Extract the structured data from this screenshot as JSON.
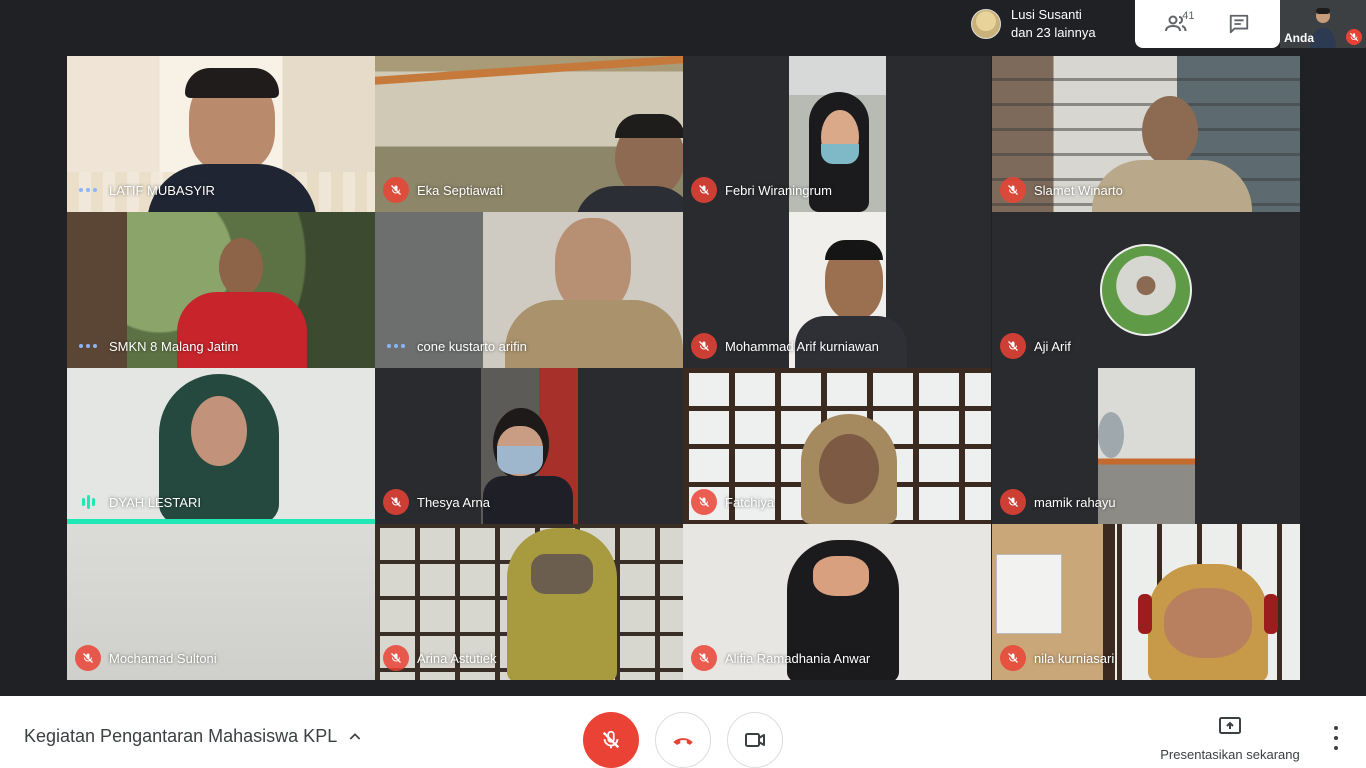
{
  "presenter": {
    "name": "Lusi Susanti",
    "others": "dan 23 lainnya"
  },
  "top_actions": {
    "people_count": "41"
  },
  "self_view": {
    "label": "Anda"
  },
  "participants": [
    {
      "name": "LATIF MUBASYIR",
      "status": "connecting"
    },
    {
      "name": "Eka Septiawati",
      "status": "muted"
    },
    {
      "name": "Febri Wiraningrum",
      "status": "muted"
    },
    {
      "name": "Slamet Winarto",
      "status": "muted"
    },
    {
      "name": "SMKN 8 Malang Jatim",
      "status": "connecting"
    },
    {
      "name": "cone kustarto arifin",
      "status": "connecting"
    },
    {
      "name": "Mohammad Arif kurniawan",
      "status": "muted"
    },
    {
      "name": "Aji Arif",
      "status": "muted"
    },
    {
      "name": "DYAH LESTARI",
      "status": "speaking"
    },
    {
      "name": "Thesya Arna",
      "status": "muted"
    },
    {
      "name": "Fatchiya",
      "status": "muted"
    },
    {
      "name": "mamik rahayu",
      "status": "muted"
    },
    {
      "name": "Mochamad Sultoni",
      "status": "muted"
    },
    {
      "name": "Arina Astutiek",
      "status": "muted"
    },
    {
      "name": "Alifia Ramadhania Anwar",
      "status": "muted"
    },
    {
      "name": "nila kurniasari",
      "status": "muted"
    }
  ],
  "bottom_bar": {
    "meeting_title": "Kegiatan Pengantaran Mahasiswa KPL",
    "present_label": "Presentasikan sekarang"
  },
  "colors": {
    "mic_off": "#ea4335",
    "speaking": "#1ee8b6",
    "background": "#202124"
  },
  "icons": [
    "people-icon",
    "chat-icon",
    "mic-off-icon",
    "hangup-icon",
    "camera-icon",
    "present-icon",
    "more-icon",
    "chevron-up-icon"
  ]
}
